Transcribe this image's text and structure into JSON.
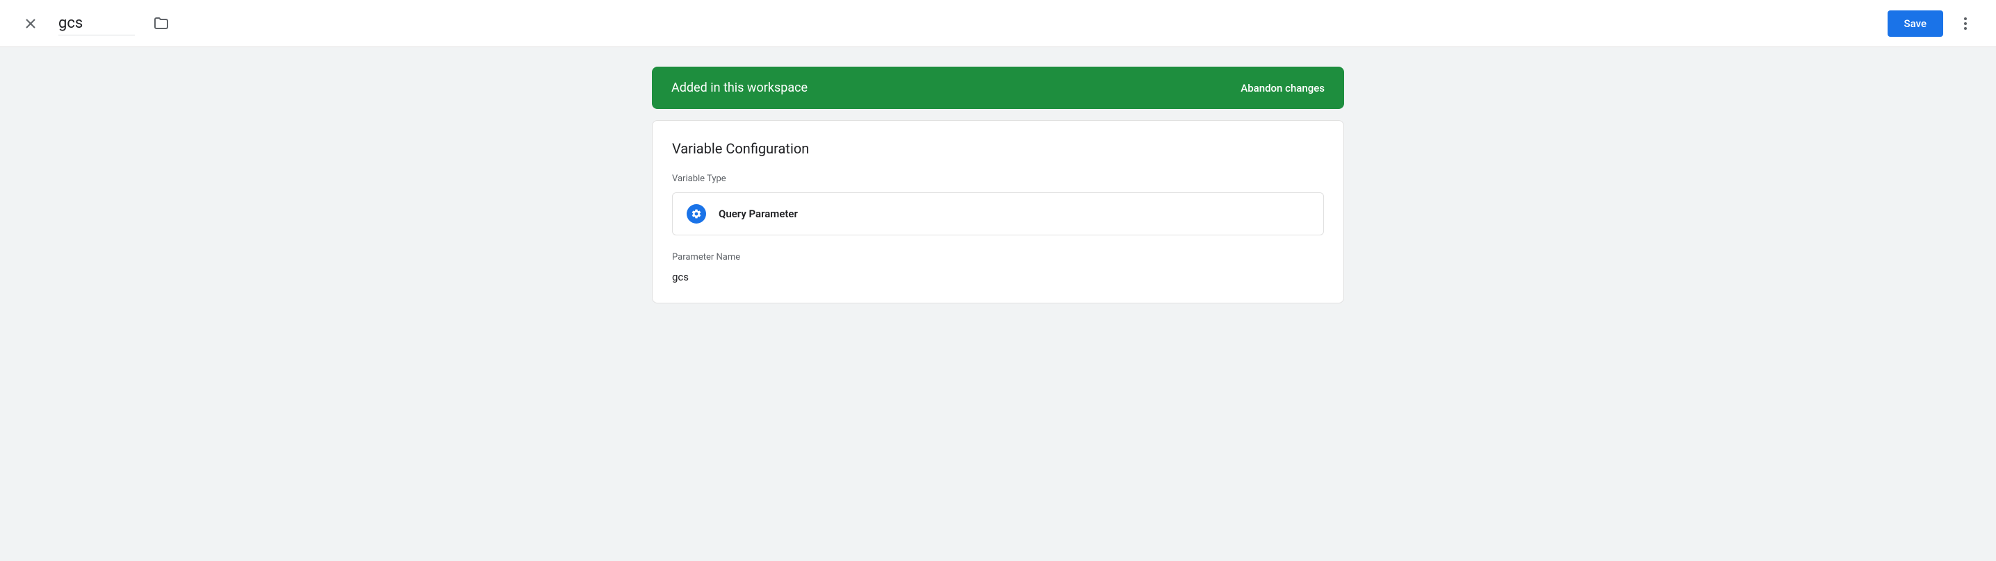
{
  "header": {
    "title_value": "gcs",
    "save_label": "Save"
  },
  "banner": {
    "text": "Added in this workspace",
    "abandon_label": "Abandon changes"
  },
  "config": {
    "card_title": "Variable Configuration",
    "type_label": "Variable Type",
    "type_value": "Query Parameter",
    "param_label": "Parameter Name",
    "param_value": "gcs"
  }
}
